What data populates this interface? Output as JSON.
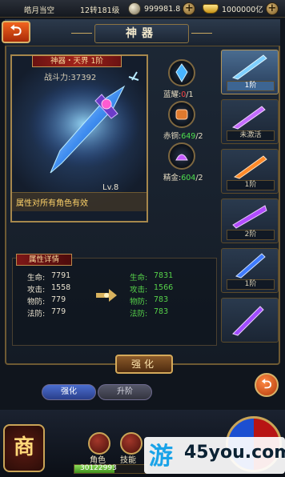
{
  "topbar": {
    "server": "皓月当空",
    "level": "12转181级",
    "silver": "999981.8",
    "gold": "1000000亿"
  },
  "header": {
    "title": "神器",
    "back_icon": "back-arrow-icon"
  },
  "weapon": {
    "tag": "神器・天界 1阶",
    "power": "战斗力:37392",
    "level": "Lv.8",
    "note": "属性对所有角色有效"
  },
  "materials": [
    {
      "name": "蓝耀",
      "current": "0",
      "required": "/1",
      "icon": "blue-crystal-icon"
    },
    {
      "name": "赤铜",
      "current": "649",
      "required": "/2",
      "icon": "red-copper-icon"
    },
    {
      "name": "精金",
      "current": "604",
      "required": "/2",
      "icon": "fine-gold-icon"
    }
  ],
  "tabs": [
    {
      "label": "1阶",
      "active": true
    },
    {
      "label": "未激活",
      "active": false
    },
    {
      "label": "1阶",
      "active": false
    },
    {
      "label": "2阶",
      "active": false
    },
    {
      "label": "1阶",
      "active": false
    },
    {
      "label": "",
      "active": false
    }
  ],
  "details": {
    "title": "属性详情",
    "current": [
      {
        "name": "生命:",
        "value": "7791"
      },
      {
        "name": "攻击:",
        "value": "1558"
      },
      {
        "name": "物防:",
        "value": "779"
      },
      {
        "name": "法防:",
        "value": "779"
      }
    ],
    "next": [
      {
        "name": "生命:",
        "value": "7831"
      },
      {
        "name": "攻击:",
        "value": "1566"
      },
      {
        "name": "物防:",
        "value": "783"
      },
      {
        "name": "法防:",
        "value": "783"
      }
    ]
  },
  "buttons": {
    "upgrade_main": "强化",
    "tab_upgrade": "强化",
    "tab_advance": "升阶"
  },
  "bottom": {
    "shop": "商",
    "role": "角色",
    "skill": "技能",
    "exp_text": "30122993",
    "exp_progress": 0.55
  },
  "watermark": {
    "you": "游",
    "site": "45you.com"
  }
}
